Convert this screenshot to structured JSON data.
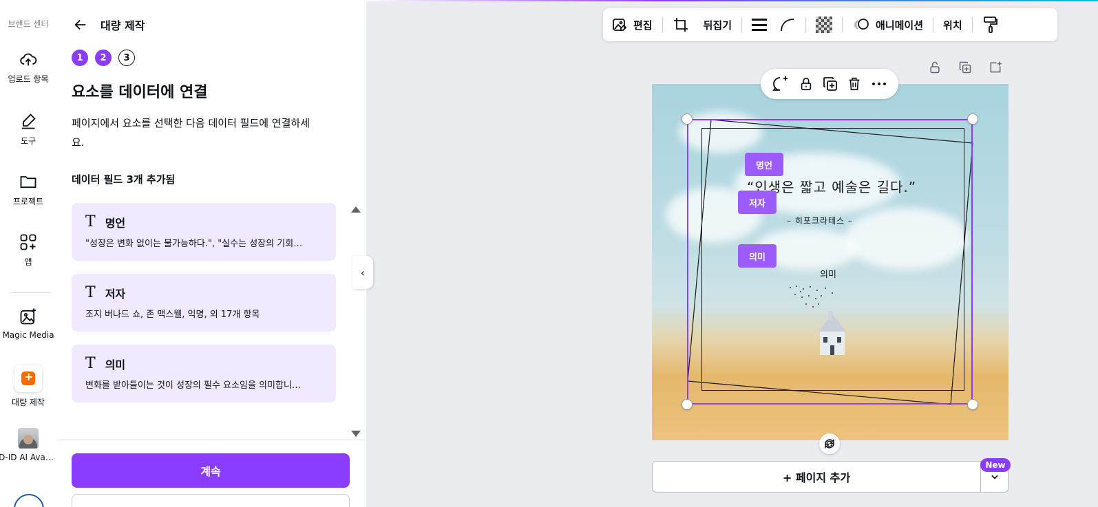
{
  "rail": {
    "brand": "브랜드 센터",
    "items": [
      {
        "label": "업로드 항목",
        "icon": "cloud-upload-icon"
      },
      {
        "label": "도구",
        "icon": "pen-tool-icon"
      },
      {
        "label": "프로젝트",
        "icon": "folder-icon"
      },
      {
        "label": "앱",
        "icon": "apps-grid-icon"
      },
      {
        "label": "Magic Media",
        "icon": "magic-media-icon"
      },
      {
        "label": "대량 제작",
        "icon": "bulk-create-icon"
      },
      {
        "label": "D-ID AI Ava…",
        "icon": "avatar-icon"
      }
    ]
  },
  "panel": {
    "title": "대량 제작",
    "steps": [
      "1",
      "2",
      "3"
    ],
    "heading": "요소를 데이터에 연결",
    "description": "페이지에서 요소를 선택한 다음 데이터 필드에 연결하세요.",
    "count_label": "데이터 필드 3개 추가됨",
    "fields": [
      {
        "name": "명언",
        "preview": "\"성장은 변화 없이는 불가능하다.\", \"실수는 성장의 기회…"
      },
      {
        "name": "저자",
        "preview": "조지 버나드 쇼, 존 맥스웰, 익명, 외 17개 항목"
      },
      {
        "name": "의미",
        "preview": "변화를 받아들이는 것이 성장의 필수 요소임을 의미합니…"
      }
    ],
    "continue_label": "계속"
  },
  "toolbar": {
    "edit_label": "편집",
    "flip_label": "뒤집기",
    "animate_label": "애니메이션",
    "position_label": "위치"
  },
  "canvas": {
    "quote": "“인생은 짧고 예술은 길다.”",
    "author": "– 히포크라테스 –",
    "meaning": "의미",
    "tags": {
      "quote": "명언",
      "author": "저자",
      "meaning": "의미"
    }
  },
  "footer": {
    "add_page_label": "+ 페이지 추가",
    "new_badge": "New"
  },
  "colors": {
    "accent": "#8b3dff",
    "card_bg": "#f1e9ff",
    "tag": "#9c5cff"
  }
}
